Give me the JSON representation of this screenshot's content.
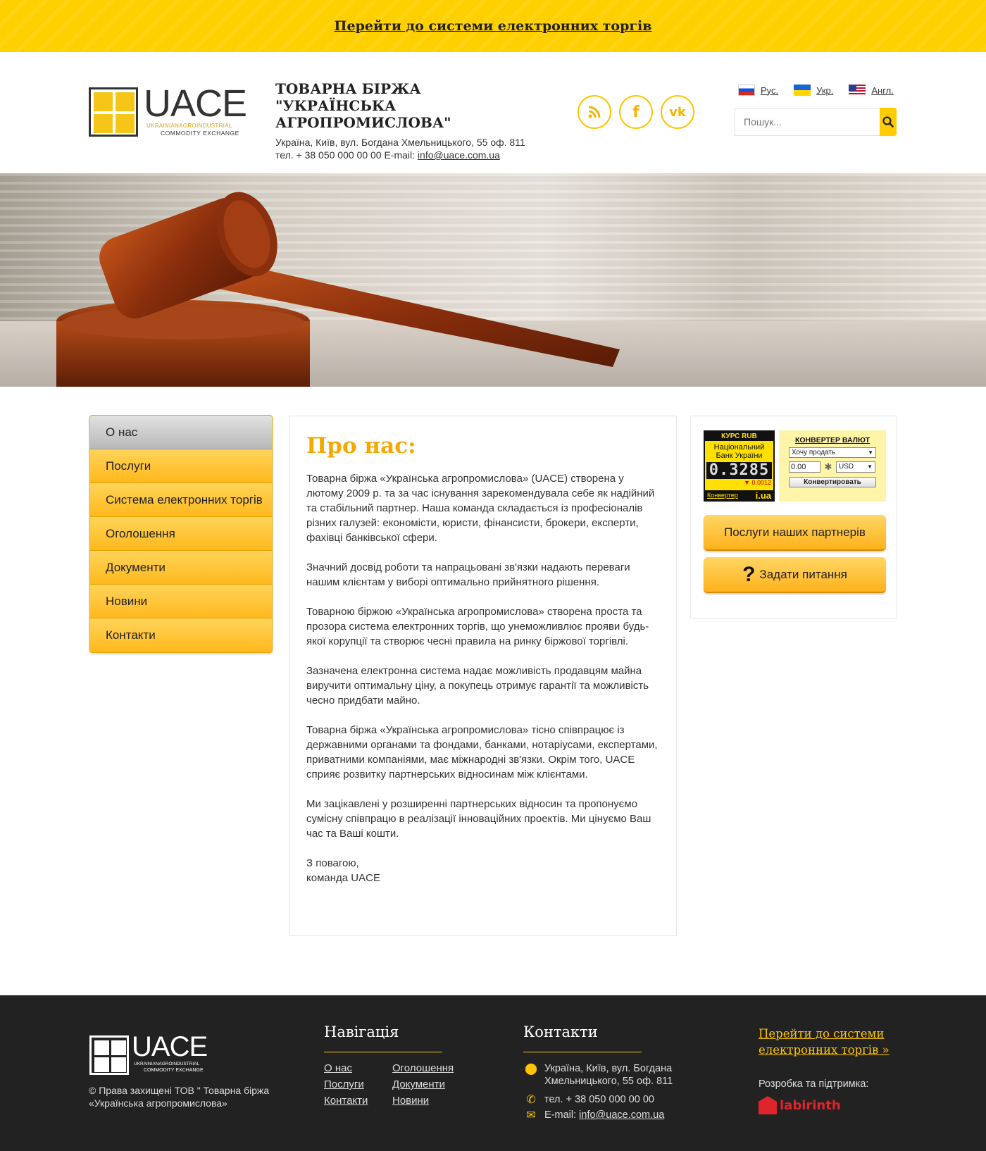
{
  "topbar": {
    "link": "Перейти до системи електронних торгів"
  },
  "logo": {
    "word": "UACE",
    "sub1": "UKRAINIANAGROINDUSTRIAL",
    "sub2": "COMMODITY EXCHANGE"
  },
  "company": {
    "name_line1": "ТОВАРНА БІРЖА",
    "name_line2": "\"УКРАЇНСЬКА АГРОПРОМИСЛОВА\"",
    "address": "Україна, Київ, вул. Богдана Хмельницького, 55 оф. 811",
    "phone_email_prefix": "тел. + 38 050 000 00 00  E-mail: ",
    "email": "info@uace.com.ua"
  },
  "socials": [
    {
      "name": "rss-icon",
      "glyph": "◉"
    },
    {
      "name": "facebook-icon",
      "glyph": "f"
    },
    {
      "name": "vk-icon",
      "glyph": "vk"
    }
  ],
  "languages": [
    {
      "label": "Рус."
    },
    {
      "label": "Укр."
    },
    {
      "label": "Англ."
    }
  ],
  "search": {
    "placeholder": "Пошук..."
  },
  "sidebar": {
    "items": [
      {
        "label": "О нас",
        "active": true
      },
      {
        "label": "Послуги"
      },
      {
        "label": "Система електронних торгів"
      },
      {
        "label": "Оголошення"
      },
      {
        "label": "Документи"
      },
      {
        "label": "Новини"
      },
      {
        "label": "Контакти"
      }
    ]
  },
  "main": {
    "title": "Про нас:",
    "paragraphs": [
      "Товарна біржа «Українська агропромислова» (UACE) створена у лютому 2009 р. та за час існування зарекомендувала себе як надійний та стабільний партнер. Наша команда складається із професіоналів різних галузей: економісти, юристи, фінансисти, брокери, експерти, фахівці банківської сфери.",
      "Значний досвід роботи та напрацьовані зв'язки надають переваги нашим клієнтам у виборі оптимально прийнятного рішення.",
      "Товарною біржою «Українська агропромислова» створена проста та прозора система електронних торгів, що унеможливлює прояви будь-якої корупції та створює чесні правила на ринку біржової торгівлі.",
      "Зазначена електронна система надає можливість продавцям майна виручити оптимальну ціну, а покупець отримує гарантії та можливість чесно придбати майно.",
      "Товарна біржа «Українська агропромислова» тісно співпрацює із державними органами та фондами, банками, нотаріусами, експертами, приватними компаніями, має міжнародні зв'язки. Окрім того, UACE сприяє розвитку партнерських відносинам між клієнтами.",
      "Ми зацікавлені у розширенні партнерських відносин та пропонуємо сумісну співпрацю в реалізації інноваційних проектів. Ми цінуємо Ваш час та Ваші кошти.",
      "З повагою,\nкоманда UACE"
    ]
  },
  "rate_widget": {
    "header": "КУРС RUB",
    "bank": "Національний Банк України",
    "value": "0.3285",
    "change": "▼ 0.0012",
    "converter_link": "Конвертер",
    "brand": "i.ua"
  },
  "converter_widget": {
    "title": "КОНВЕРТЕР ВАЛЮТ",
    "mode": "Хочу продать",
    "amount": "0.00",
    "currency": "USD",
    "button": "Конвертировать"
  },
  "right_buttons": {
    "partners": "Послуги наших партнерів",
    "ask": "Задати питання",
    "ask_glyph": "?"
  },
  "footer": {
    "logo_word": "UACE",
    "logo_sub1": "UKRAINIANAGROINDUSTRIAL",
    "logo_sub2": "COMMODITY EXCHANGE",
    "copyright": "© Права захищені ТОВ \" Товарна біржа «Українська агропромислова»",
    "nav_title": "Навігація",
    "nav": [
      "О нас",
      "Оголошення",
      "Послуги",
      "Документи",
      "Контакти",
      "Новини"
    ],
    "contacts_title": "Контакти",
    "address": "Україна, Київ, вул. Богдана Хмельницького, 55 оф. 811",
    "phone": "тел. + 38 050 000 00 00",
    "email_prefix": "E-mail: ",
    "email": "info@uace.com.ua",
    "trade_link": "Перейти до системи електронних торгів »",
    "dev_label": "Розробка та підтримка:",
    "dev_brand": "labirinth"
  },
  "colors": {
    "accent": "#ffcc00",
    "title": "#f5a800",
    "footer_bg": "#222222"
  }
}
